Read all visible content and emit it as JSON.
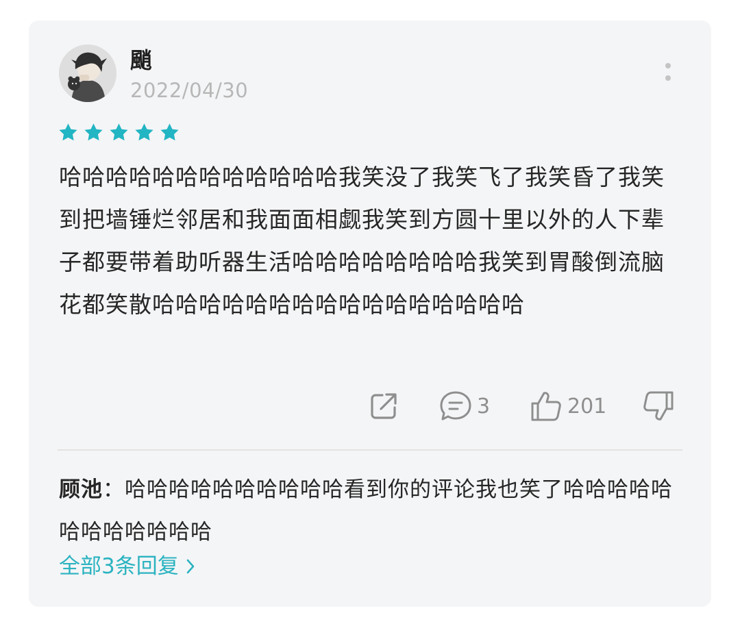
{
  "user": {
    "name": "颵",
    "date": "2022/04/30"
  },
  "rating": {
    "stars": 5,
    "max": 5,
    "color": "#22b5c3"
  },
  "review": {
    "text": "哈哈哈哈哈哈哈哈哈哈哈哈我笑没了我笑飞了我笑昏了我笑到把墙锤烂邻居和我面面相觑我笑到方圆十里以外的人下辈子都要带着助听器生活哈哈哈哈哈哈哈哈我笑到胃酸倒流脑花都笑散哈哈哈哈哈哈哈哈哈哈哈哈哈哈哈哈"
  },
  "actions": {
    "share_icon": "share-icon",
    "comment_icon": "comment-icon",
    "comment_count": "3",
    "like_icon": "thumbs-up-icon",
    "like_count": "201",
    "dislike_icon": "thumbs-down-icon"
  },
  "reply": {
    "author": "顾池",
    "separator": "：",
    "text": "哈哈哈哈哈哈哈哈哈哈看到你的评论我也笑了哈哈哈哈哈哈哈哈哈哈哈哈"
  },
  "replies_link": {
    "label": "全部3条回复",
    "icon": "chevron-right-icon"
  },
  "colors": {
    "accent": "#2bb3c0",
    "card_bg": "#f4f5f7",
    "text": "#262626",
    "muted": "#8e8e8e"
  }
}
